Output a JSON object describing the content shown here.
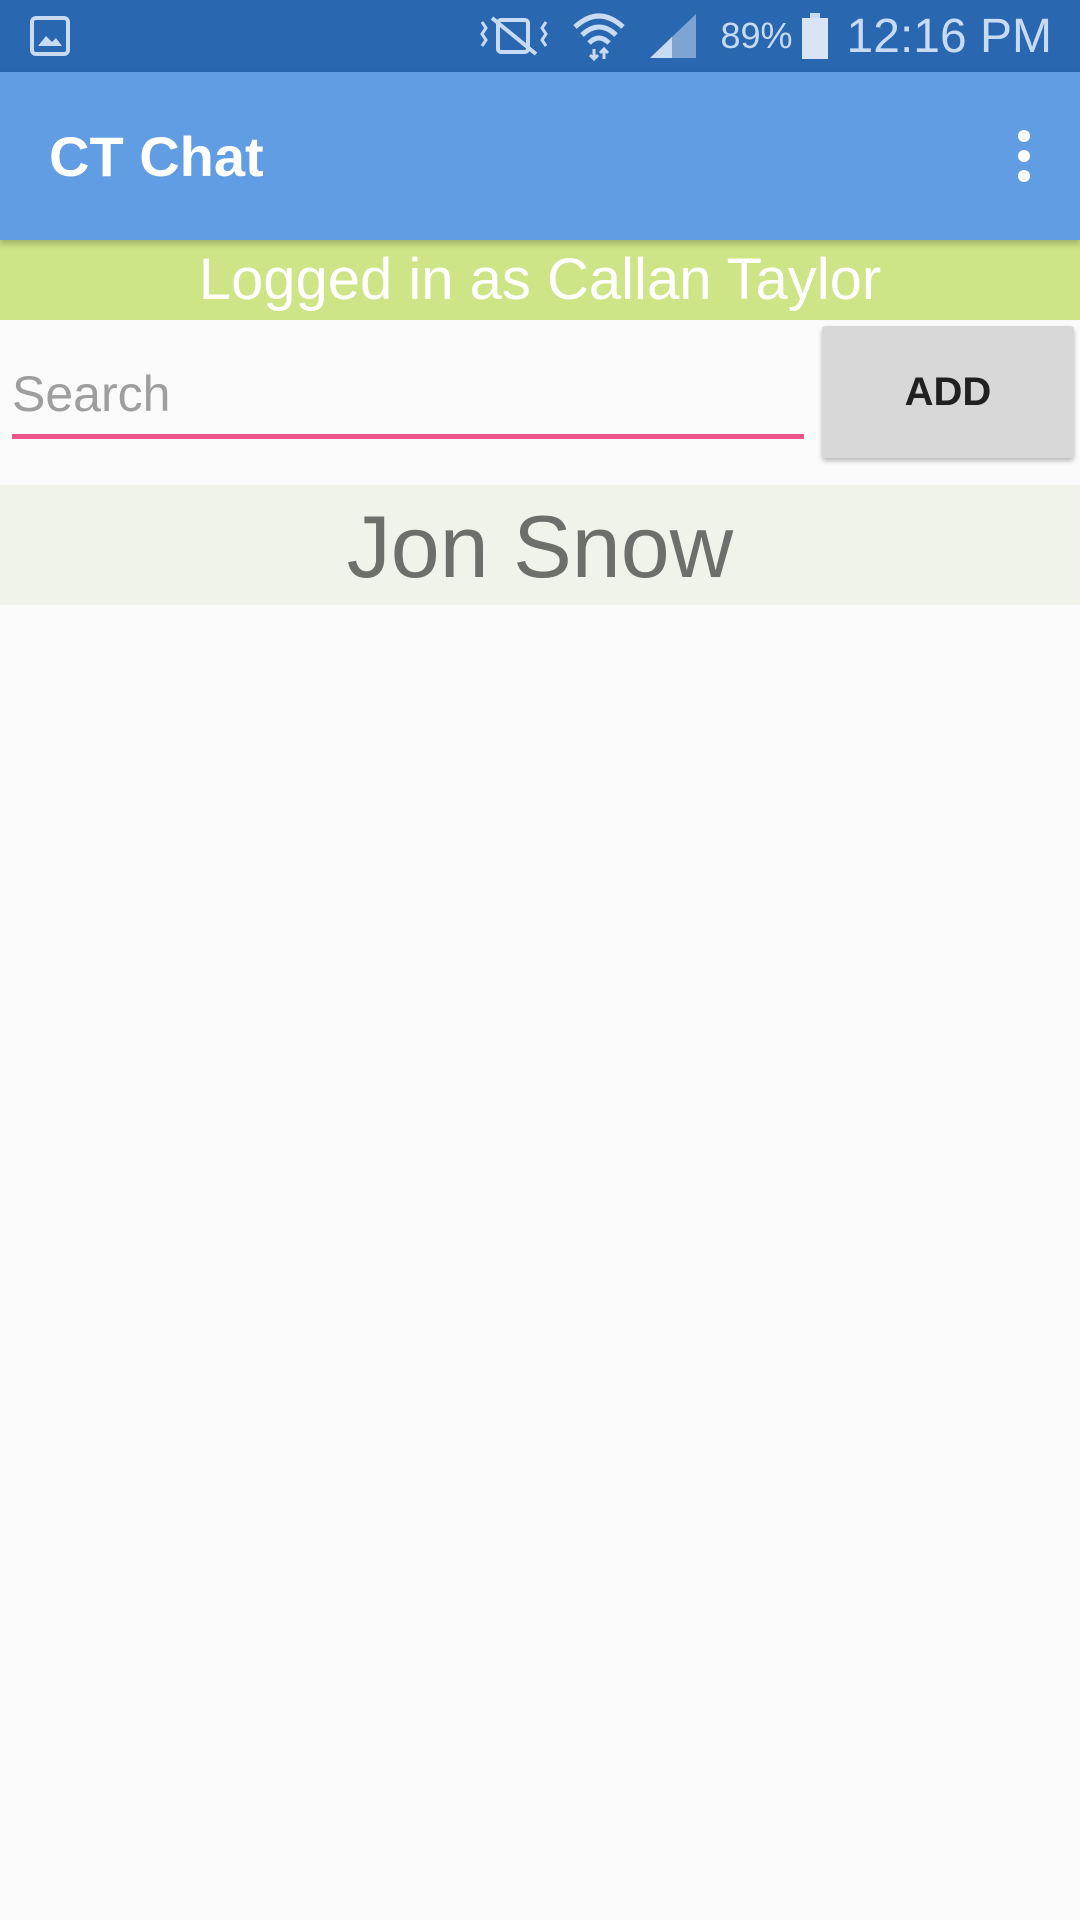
{
  "status_bar": {
    "battery_percent": "89%",
    "time": "12:16 PM",
    "icons": [
      "gallery-notification-icon",
      "vibrate-icon",
      "wifi-icon",
      "signal-icon",
      "battery-icon"
    ]
  },
  "app_bar": {
    "title": "CT Chat",
    "menu_icon": "overflow-menu-icon"
  },
  "login_banner": {
    "text": "Logged in as Callan Taylor"
  },
  "search": {
    "value": "",
    "placeholder": "Search"
  },
  "add_button": {
    "label": "ADD"
  },
  "contacts": [
    {
      "name": "Jon Snow"
    }
  ],
  "colors": {
    "status_bar": "#2a67b1",
    "app_bar": "#619de2",
    "banner": "#cde487",
    "accent": "#f0538a",
    "contact_bg": "#f0f3ea"
  }
}
